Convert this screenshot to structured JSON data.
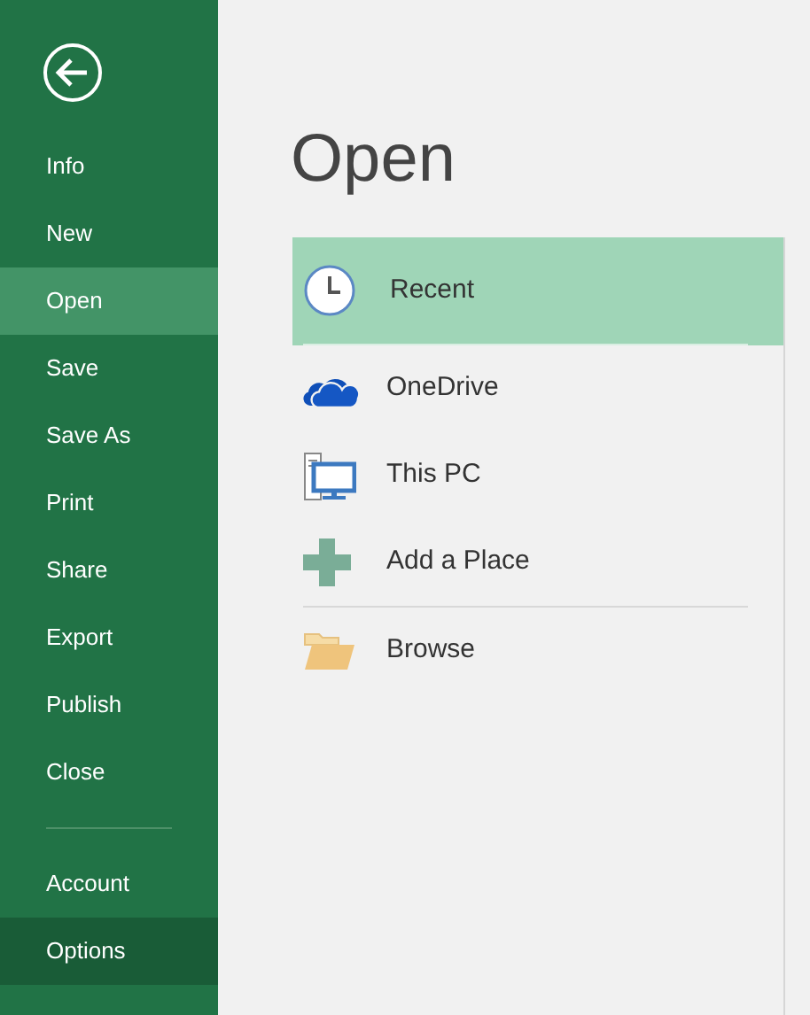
{
  "sidebar": {
    "items": [
      {
        "label": "Info",
        "selected": false,
        "hovered": false
      },
      {
        "label": "New",
        "selected": false,
        "hovered": false
      },
      {
        "label": "Open",
        "selected": true,
        "hovered": false
      },
      {
        "label": "Save",
        "selected": false,
        "hovered": false
      },
      {
        "label": "Save As",
        "selected": false,
        "hovered": false
      },
      {
        "label": "Print",
        "selected": false,
        "hovered": false
      },
      {
        "label": "Share",
        "selected": false,
        "hovered": false
      },
      {
        "label": "Export",
        "selected": false,
        "hovered": false
      },
      {
        "label": "Publish",
        "selected": false,
        "hovered": false
      },
      {
        "label": "Close",
        "selected": false,
        "hovered": false
      }
    ],
    "bottom_items": [
      {
        "label": "Account",
        "selected": false,
        "hovered": false
      },
      {
        "label": "Options",
        "selected": false,
        "hovered": true
      }
    ]
  },
  "title": "Open",
  "places": [
    {
      "label": "Recent",
      "selected": true,
      "divider_after": true
    },
    {
      "label": "OneDrive",
      "selected": false,
      "divider_after": false
    },
    {
      "label": "This PC",
      "selected": false,
      "divider_after": false
    },
    {
      "label": "Add a Place",
      "selected": false,
      "divider_after": true
    },
    {
      "label": "Browse",
      "selected": false,
      "divider_after": false
    }
  ]
}
